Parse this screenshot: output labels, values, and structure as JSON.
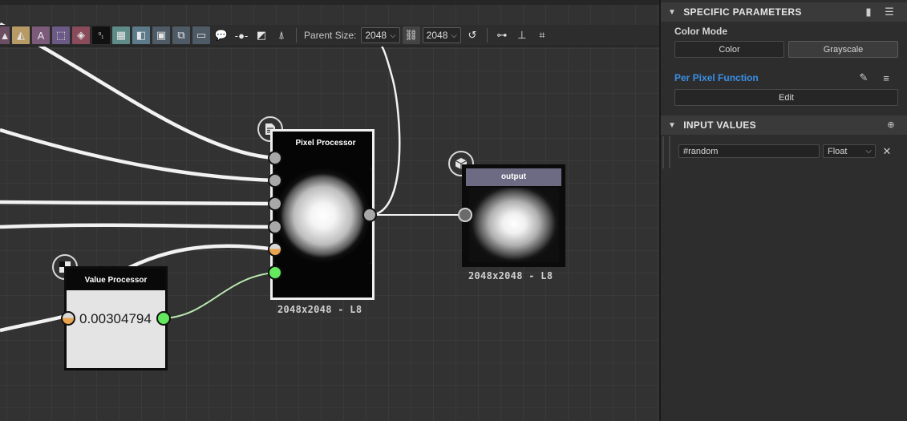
{
  "toolbar": {
    "parent_size_label": "Parent Size:",
    "parent_size_value": "2048",
    "size_value": "2048",
    "icons": [
      "mirror-icon",
      "text-icon",
      "transform-icon",
      "paint-bucket-icon",
      "bit-depth-icon",
      "fx-map-icon",
      "input-icon",
      "frame-icon",
      "comment-icon",
      "link-icon",
      "pin-icon",
      "layout-icon",
      "lock-link-icon",
      "reset-icon",
      "align-horizontal-icon",
      "align-vertical-icon",
      "snap-icon"
    ]
  },
  "graph": {
    "pixel_node": {
      "title": "Pixel Processor",
      "resolution": "2048x2048 - L8"
    },
    "output_node": {
      "title": "output",
      "resolution": "2048x2048 - L8"
    },
    "value_node": {
      "title": "Value Processor",
      "value": "0.00304794"
    }
  },
  "panel": {
    "specific_parameters": {
      "header": "SPECIFIC PARAMETERS",
      "color_mode_label": "Color Mode",
      "color_button": "Color",
      "grayscale_button": "Grayscale",
      "per_pixel_label": "Per Pixel Function",
      "edit_button": "Edit"
    },
    "input_values": {
      "header": "INPUT VALUES",
      "row_name": "#random",
      "row_type": "Float"
    }
  },
  "colors": {
    "accent_blue": "#3a8fe6",
    "port_green": "#63e85e",
    "port_orange": "#e8a44e",
    "output_title": "#6d6a83"
  }
}
